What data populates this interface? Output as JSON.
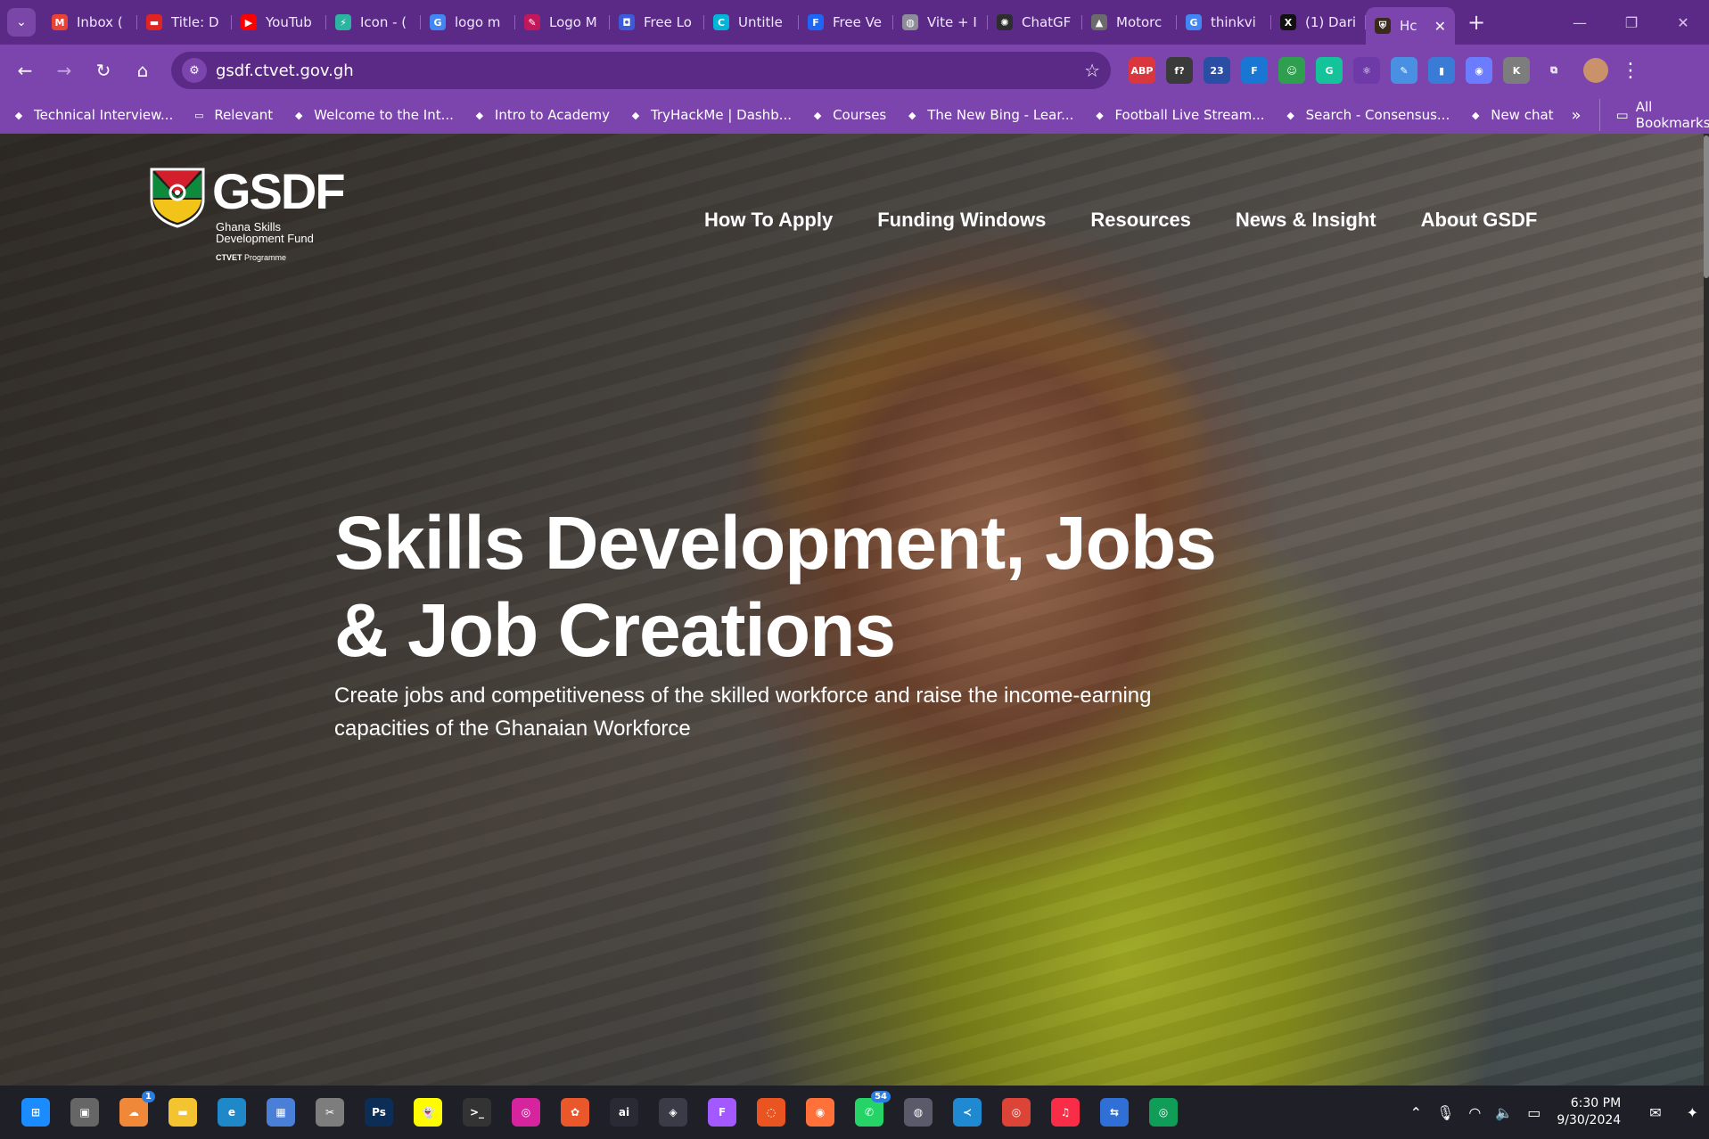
{
  "browser": {
    "tabs": [
      {
        "title": "Inbox (",
        "icon": "gmail-icon",
        "color": "#ea4335",
        "glyph": "M"
      },
      {
        "title": "Title: D",
        "icon": "doc-icon",
        "color": "#e02424",
        "glyph": "▬"
      },
      {
        "title": "YouTub",
        "icon": "youtube-icon",
        "color": "#ff0000",
        "glyph": "▶"
      },
      {
        "title": "Icon - (",
        "icon": "icon-site-icon",
        "color": "#2bb5a0",
        "glyph": "⚡"
      },
      {
        "title": "logo m",
        "icon": "google-icon",
        "color": "#4285f4",
        "glyph": "G"
      },
      {
        "title": "Logo M",
        "icon": "logo-maker-icon",
        "color": "#c2185b",
        "glyph": "✎"
      },
      {
        "title": "Free Lo",
        "icon": "free-logo-icon",
        "color": "#3b5bdb",
        "glyph": "◘"
      },
      {
        "title": "Untitle",
        "icon": "canva-icon",
        "color": "#00b5d8",
        "glyph": "C"
      },
      {
        "title": "Free Ve",
        "icon": "free-vector-icon",
        "color": "#1e66f5",
        "glyph": "F"
      },
      {
        "title": "Vite + I",
        "icon": "globe-icon",
        "color": "#8d8d99",
        "glyph": "◍"
      },
      {
        "title": "ChatGF",
        "icon": "chatgpt-icon",
        "color": "#2d2d2d",
        "glyph": "✺"
      },
      {
        "title": "Motorc",
        "icon": "image-icon",
        "color": "#6b6b6b",
        "glyph": "▲"
      },
      {
        "title": "thinkvi",
        "icon": "google-icon",
        "color": "#4285f4",
        "glyph": "G"
      },
      {
        "title": "(1) Dari",
        "icon": "x-icon",
        "color": "#111111",
        "glyph": "X"
      }
    ],
    "active_tab": {
      "title": "Hc",
      "icon": "gsdf-favicon-icon"
    },
    "url": "gsdf.ctvet.gov.gh",
    "bookmarks": [
      {
        "label": "Technical Interview...",
        "icon": "bookmark-page-icon"
      },
      {
        "label": "Relevant",
        "icon": "folder-icon"
      },
      {
        "label": "Welcome to the Int...",
        "icon": "bookmark-page-icon"
      },
      {
        "label": "Intro to Academy",
        "icon": "cube-icon"
      },
      {
        "label": "TryHackMe | Dashb...",
        "icon": "tryhackme-icon"
      },
      {
        "label": "Courses",
        "icon": "courses-icon"
      },
      {
        "label": "The New Bing - Lear...",
        "icon": "bing-icon"
      },
      {
        "label": "Football Live Stream...",
        "icon": "football-icon"
      },
      {
        "label": "Search - Consensus...",
        "icon": "consensus-icon"
      },
      {
        "label": "New chat",
        "icon": "chatgpt-icon"
      }
    ],
    "all_bookmarks_label": "All Bookmarks",
    "extensions": [
      {
        "icon": "adblock-icon",
        "glyph": "ABP",
        "color": "#d9373d"
      },
      {
        "icon": "font-icon",
        "glyph": "f?",
        "color": "#3a3a3a"
      },
      {
        "icon": "ext-hat-icon",
        "glyph": "23",
        "color": "#2a4ea3"
      },
      {
        "icon": "ext-f-icon",
        "glyph": "F",
        "color": "#1976d2"
      },
      {
        "icon": "ext-robot-icon",
        "glyph": "☺",
        "color": "#2e9e4f"
      },
      {
        "icon": "grammarly-icon",
        "glyph": "G",
        "color": "#15c39a"
      },
      {
        "icon": "react-icon",
        "glyph": "⚛",
        "color": "#6e3aa8"
      },
      {
        "icon": "ext-edit-icon",
        "glyph": "✎",
        "color": "#4a90e2"
      },
      {
        "icon": "ext-book-icon",
        "glyph": "▮",
        "color": "#3a7bd5"
      },
      {
        "icon": "ext-circle-icon",
        "glyph": "◉",
        "color": "#6b7cff"
      },
      {
        "icon": "ext-k-icon",
        "glyph": "K",
        "color": "#7d7d7d"
      },
      {
        "icon": "puzzle-icon",
        "glyph": "⧉",
        "color": "#7b45ad"
      }
    ]
  },
  "page": {
    "logo": {
      "word": "GSDF",
      "sub1": "Ghana Skills",
      "sub2": "Development Fund",
      "prog_bold": "CTVET",
      "prog": "Programme"
    },
    "nav": [
      "How To Apply",
      "Funding Windows",
      "Resources",
      "News & Insight",
      "About GSDF"
    ],
    "headline_line1": "Skills Development, Jobs",
    "headline_line2": "& Job Creations",
    "subtitle_line1": "Create jobs and competitiveness of the skilled workforce and raise the income-earning",
    "subtitle_line2": "capacities of the Ghanaian Workforce"
  },
  "taskbar": {
    "apps": [
      {
        "icon": "windows-start-icon",
        "glyph": "⊞",
        "color": "#1a8cff"
      },
      {
        "icon": "task-view-icon",
        "glyph": "▣",
        "color": "#666666"
      },
      {
        "icon": "weather-icon",
        "glyph": "☁",
        "color": "#f0883a",
        "badge": "1"
      },
      {
        "icon": "file-explorer-icon",
        "glyph": "▬",
        "color": "#f4c430"
      },
      {
        "icon": "edge-icon",
        "glyph": "e",
        "color": "#1e88c9"
      },
      {
        "icon": "store-icon",
        "glyph": "▦",
        "color": "#4a7fd8"
      },
      {
        "icon": "snipping-icon",
        "glyph": "✂",
        "color": "#7d7d7d"
      },
      {
        "icon": "photoshop-icon",
        "glyph": "Ps",
        "color": "#0b2d56"
      },
      {
        "icon": "snapchat-icon",
        "glyph": "👻",
        "color": "#fffc00"
      },
      {
        "icon": "terminal-icon",
        "glyph": ">_",
        "color": "#333333"
      },
      {
        "icon": "instagram-icon",
        "glyph": "◎",
        "color": "#d6249f"
      },
      {
        "icon": "photos-icon",
        "glyph": "✿",
        "color": "#e9572b"
      },
      {
        "icon": "ai-app-icon",
        "glyph": "ai",
        "color": "#2a2a35"
      },
      {
        "icon": "davinci-icon",
        "glyph": "◈",
        "color": "#3b3b48"
      },
      {
        "icon": "figma-icon",
        "glyph": "F",
        "color": "#a259ff"
      },
      {
        "icon": "ubuntu-icon",
        "glyph": "◌",
        "color": "#e95420"
      },
      {
        "icon": "firefox-icon",
        "glyph": "◉",
        "color": "#ff7139"
      },
      {
        "icon": "whatsapp-icon",
        "glyph": "✆",
        "color": "#25d366",
        "badge": "54"
      },
      {
        "icon": "github-icon",
        "glyph": "◍",
        "color": "#5a5a6a"
      },
      {
        "icon": "vscode-icon",
        "glyph": "≺",
        "color": "#1f8ad2"
      },
      {
        "icon": "chrome-icon",
        "glyph": "◎",
        "color": "#db4437"
      },
      {
        "icon": "music-icon",
        "glyph": "♫",
        "color": "#fa2d48"
      },
      {
        "icon": "remote-icon",
        "glyph": "⇆",
        "color": "#2f6fd6"
      },
      {
        "icon": "chrome-profile-icon",
        "glyph": "◎",
        "color": "#0f9d58"
      }
    ],
    "time": "6:30 PM",
    "date": "9/30/2024"
  }
}
